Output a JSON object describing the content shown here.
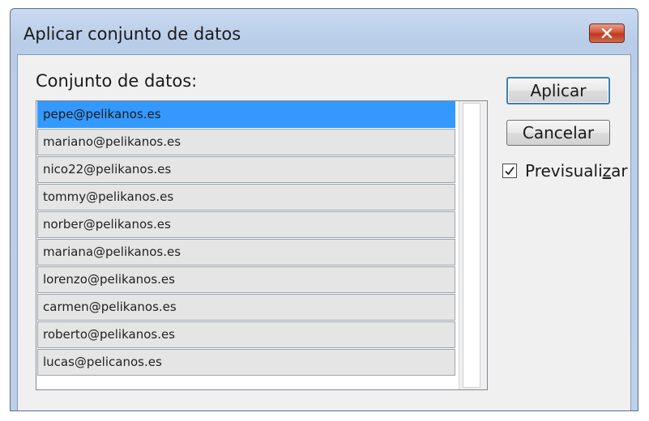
{
  "window": {
    "title": "Aplicar conjunto de datos",
    "close_icon": "close-icon"
  },
  "dataset_list": {
    "label": "Conjunto de datos:",
    "selected_index": 0,
    "items": [
      "pepe@pelikanos.es",
      "mariano@pelikanos.es",
      "nico22@pelikanos.es",
      "tommy@pelikanos.es",
      "norber@pelikanos.es",
      "mariana@pelikanos.es",
      "lorenzo@pelikanos.es",
      "carmen@pelikanos.es",
      "roberto@pelikanos.es",
      "lucas@pelicanos.es"
    ]
  },
  "buttons": {
    "apply_label": "Aplicar",
    "cancel_label": "Cancelar"
  },
  "preview": {
    "label_before": "Previsuali",
    "label_mnemonic": "z",
    "label_after": "ar",
    "checked": true
  },
  "colors": {
    "selection": "#3399ff",
    "close_button": "#c0391d"
  }
}
